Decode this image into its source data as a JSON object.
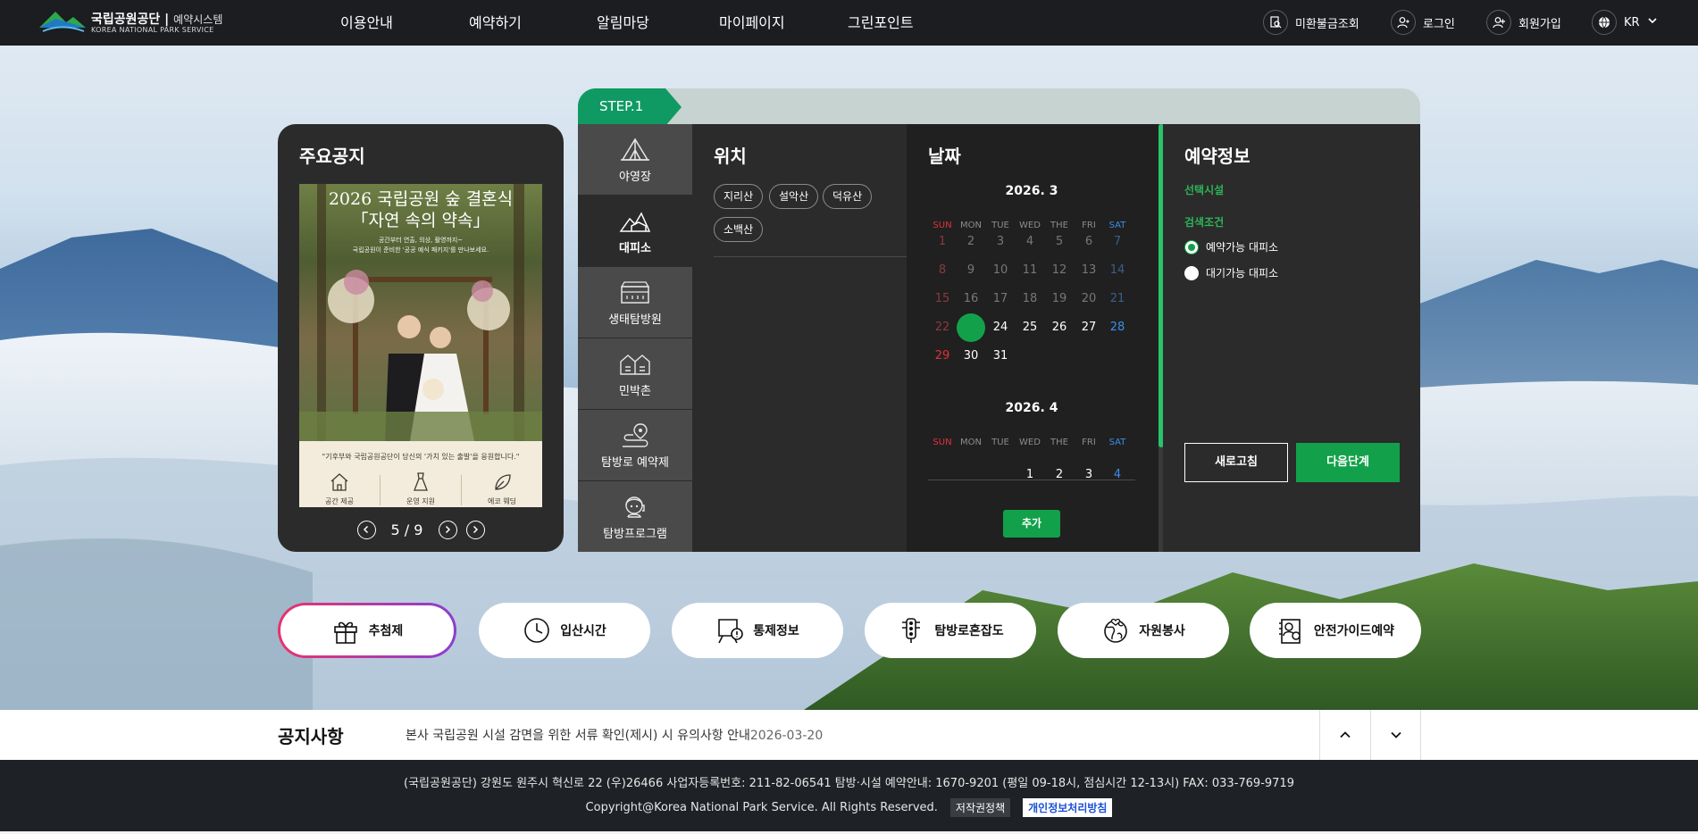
{
  "header": {
    "logo_name": "국립공원공단",
    "logo_system": "예약시스템",
    "logo_en": "KOREA NATIONAL PARK SERVICE",
    "nav": [
      "이용안내",
      "예약하기",
      "알림마당",
      "마이페이지",
      "그린포인트"
    ],
    "util": {
      "refund": "미환불금조회",
      "login": "로그인",
      "signup": "회원가입",
      "lang": "KR"
    }
  },
  "notice_card": {
    "title": "주요공지",
    "poster": {
      "title_line1": "2026 국립공원 숲 결혼식",
      "title_line2": "「자연 속의 약속」",
      "sub_line1": "공간부터 연출, 의상, 촬영까지~",
      "sub_line2": "국립공원이 준비한 '공공 예식 패키지'를 만나보세요.",
      "caption": "\"기후부와 국립공원공단이 당신의 '가치 있는 출발'을 응원합니다.\"",
      "features": [
        "공간 제공",
        "운영 지원",
        "에코 웨딩"
      ]
    },
    "pager": {
      "current": "5",
      "sep": "/",
      "total": "9"
    }
  },
  "step": {
    "label": "STEP.1"
  },
  "categories": [
    {
      "label": "야영장",
      "icon": "tent-icon"
    },
    {
      "label": "대피소",
      "icon": "shelter-icon"
    },
    {
      "label": "생태탐방원",
      "icon": "eco-center-icon"
    },
    {
      "label": "민박촌",
      "icon": "village-icon"
    },
    {
      "label": "탐방로 예약제",
      "icon": "trail-pin-icon"
    },
    {
      "label": "탐방프로그램",
      "icon": "guide-icon"
    }
  ],
  "location": {
    "title": "위치",
    "chips": [
      "지리산",
      "설악산",
      "덕유산",
      "소백산"
    ]
  },
  "date": {
    "title": "날짜",
    "dow": [
      "SUN",
      "MON",
      "TUE",
      "WED",
      "THE",
      "FRI",
      "SAT"
    ],
    "months": [
      {
        "label": "2026. 3",
        "weeks": [
          [
            "1",
            "2",
            "3",
            "4",
            "5",
            "6",
            "7"
          ],
          [
            "8",
            "9",
            "10",
            "11",
            "12",
            "13",
            "14"
          ],
          [
            "15",
            "16",
            "17",
            "18",
            "19",
            "20",
            "21"
          ],
          [
            "22",
            "23",
            "24",
            "25",
            "26",
            "27",
            "28"
          ],
          [
            "29",
            "30",
            "31",
            "",
            "",
            "",
            ""
          ]
        ],
        "past_through": "22",
        "selected": "23"
      },
      {
        "label": "2026. 4",
        "weeks": [
          [
            "",
            "",
            "",
            "1",
            "2",
            "3",
            "4"
          ]
        ]
      }
    ],
    "add_label": "추가"
  },
  "reservation": {
    "title": "예약정보",
    "facility_label": "선택시설",
    "criteria_label": "검색조건",
    "options": [
      "예약가능 대피소",
      "대기가능 대피소"
    ],
    "selected_option": "예약가능 대피소",
    "reset_label": "새로고침",
    "next_label": "다음단계"
  },
  "quick_links": [
    {
      "label": "추첨제",
      "icon": "gift-icon"
    },
    {
      "label": "입산시간",
      "icon": "clock-icon"
    },
    {
      "label": "통제정보",
      "icon": "warning-board-icon"
    },
    {
      "label": "탐방로혼잡도",
      "icon": "traffic-light-icon"
    },
    {
      "label": "자원봉사",
      "icon": "globe-heart-icon"
    },
    {
      "label": "안전가이드예약",
      "icon": "safety-guide-icon"
    }
  ],
  "notice_strip": {
    "title": "공지사항",
    "text": "본사 국립공원 시설 감면을 위한 서류 확인(제시) 시 유의사항 안내",
    "date": "2026-03-20"
  },
  "footer": {
    "address": "(국립공원공단) 강원도 원주시 혁신로 22 (우)26466   사업자등록번호: 211-82-06541   탐방·시설 예약안내: 1670-9201 (평일 09-18시, 점심시간 12-13시)   FAX: 033-769-9719",
    "copyright": "Copyright@Korea National Park Service. All Rights Reserved.",
    "copyright_policy": "저작권정책",
    "privacy_policy": "개인정보처리방침"
  },
  "colors": {
    "accent_green": "#12a14a",
    "header_bg": "#1b1d20",
    "panel_dark": "#2b2b2b"
  }
}
